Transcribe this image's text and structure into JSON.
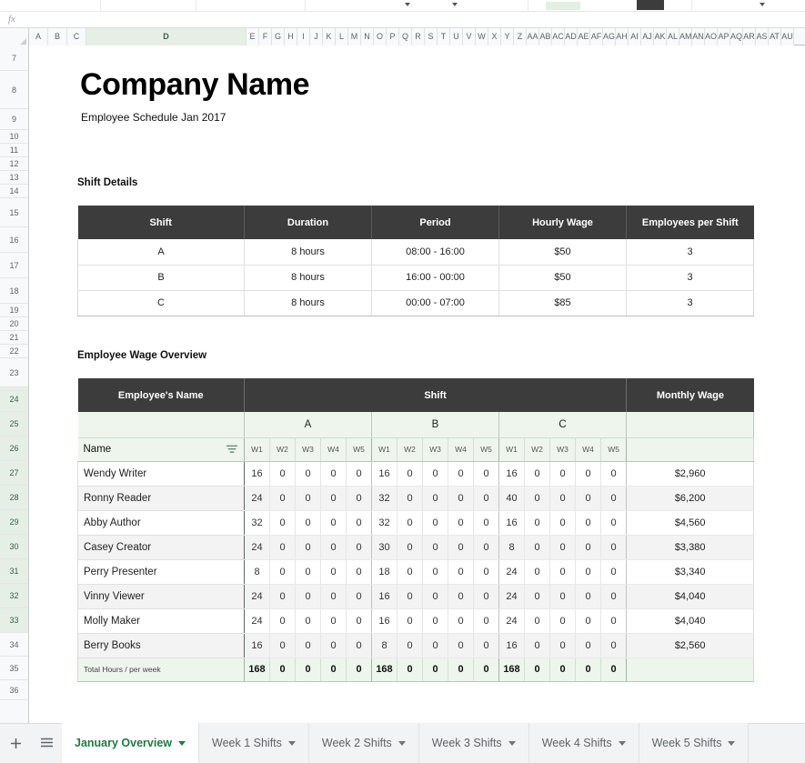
{
  "formula_bar": {
    "fx_label": "fx",
    "value": "",
    "placeholder": ""
  },
  "grid": {
    "columns": [
      "A",
      "B",
      "C",
      "D",
      "E",
      "F",
      "G",
      "H",
      "I",
      "J",
      "K",
      "L",
      "M",
      "N",
      "O",
      "P",
      "Q",
      "R",
      "S",
      "T",
      "U",
      "V",
      "W",
      "X",
      "Y",
      "Z",
      "AA",
      "AB",
      "AC",
      "AD",
      "AE",
      "AF",
      "AG",
      "AH",
      "AI",
      "AJ",
      "AK",
      "AL",
      "AM",
      "AN",
      "AO",
      "AP",
      "AQ",
      "AR",
      "AS",
      "AT",
      "AU"
    ],
    "selected_column": "D",
    "rows": [
      "7",
      "8",
      "9",
      "10",
      "11",
      "12",
      "13",
      "14",
      "15",
      "16",
      "17",
      "18",
      "19",
      "20",
      "21",
      "22",
      "23",
      "24",
      "25",
      "26",
      "27",
      "28",
      "29",
      "30",
      "31",
      "32",
      "33",
      "34",
      "35",
      "36"
    ],
    "selected_rows": [
      "24",
      "25",
      "26",
      "27",
      "28",
      "29",
      "30",
      "31",
      "32",
      "33"
    ]
  },
  "header": {
    "company_title": "Company Name",
    "subtitle": "Employee Schedule Jan 2017"
  },
  "shift_details": {
    "section_title": "Shift Details",
    "columns": [
      "Shift",
      "Duration",
      "Period",
      "Hourly Wage",
      "Employees per Shift"
    ],
    "rows": [
      {
        "shift": "A",
        "duration": "8 hours",
        "period": "08:00 - 16:00",
        "hourly_wage": "$50",
        "employees": "3"
      },
      {
        "shift": "B",
        "duration": "8 hours",
        "period": "16:00 - 00:00",
        "hourly_wage": "$50",
        "employees": "3"
      },
      {
        "shift": "C",
        "duration": "8 hours",
        "period": "00:00 - 07:00",
        "hourly_wage": "$85",
        "employees": "3"
      }
    ]
  },
  "wage_overview": {
    "section_title": "Employee Wage Overview",
    "header_name": "Employee's Name",
    "header_shift": "Shift",
    "header_monthly_wage": "Monthly Wage",
    "shift_groups": [
      "A",
      "B",
      "C"
    ],
    "week_labels": [
      "W1",
      "W2",
      "W3",
      "W4",
      "W5"
    ],
    "name_filter_label": "Name",
    "filter_icon": "filter-icon",
    "employees": [
      {
        "name": "Wendy Writer",
        "a": [
          "16",
          "0",
          "0",
          "0",
          "0"
        ],
        "b": [
          "16",
          "0",
          "0",
          "0",
          "0"
        ],
        "c": [
          "16",
          "0",
          "0",
          "0",
          "0"
        ],
        "monthly_wage": "$2,960"
      },
      {
        "name": "Ronny Reader",
        "a": [
          "24",
          "0",
          "0",
          "0",
          "0"
        ],
        "b": [
          "32",
          "0",
          "0",
          "0",
          "0"
        ],
        "c": [
          "40",
          "0",
          "0",
          "0",
          "0"
        ],
        "monthly_wage": "$6,200"
      },
      {
        "name": "Abby Author",
        "a": [
          "32",
          "0",
          "0",
          "0",
          "0"
        ],
        "b": [
          "32",
          "0",
          "0",
          "0",
          "0"
        ],
        "c": [
          "16",
          "0",
          "0",
          "0",
          "0"
        ],
        "monthly_wage": "$4,560"
      },
      {
        "name": "Casey Creator",
        "a": [
          "24",
          "0",
          "0",
          "0",
          "0"
        ],
        "b": [
          "30",
          "0",
          "0",
          "0",
          "0"
        ],
        "c": [
          "8",
          "0",
          "0",
          "0",
          "0"
        ],
        "monthly_wage": "$3,380"
      },
      {
        "name": "Perry Presenter",
        "a": [
          "8",
          "0",
          "0",
          "0",
          "0"
        ],
        "b": [
          "18",
          "0",
          "0",
          "0",
          "0"
        ],
        "c": [
          "24",
          "0",
          "0",
          "0",
          "0"
        ],
        "monthly_wage": "$3,340"
      },
      {
        "name": "Vinny Viewer",
        "a": [
          "24",
          "0",
          "0",
          "0",
          "0"
        ],
        "b": [
          "16",
          "0",
          "0",
          "0",
          "0"
        ],
        "c": [
          "24",
          "0",
          "0",
          "0",
          "0"
        ],
        "monthly_wage": "$4,040"
      },
      {
        "name": "Molly Maker",
        "a": [
          "24",
          "0",
          "0",
          "0",
          "0"
        ],
        "b": [
          "16",
          "0",
          "0",
          "0",
          "0"
        ],
        "c": [
          "24",
          "0",
          "0",
          "0",
          "0"
        ],
        "monthly_wage": "$4,040"
      },
      {
        "name": "Berry Books",
        "a": [
          "16",
          "0",
          "0",
          "0",
          "0"
        ],
        "b": [
          "8",
          "0",
          "0",
          "0",
          "0"
        ],
        "c": [
          "16",
          "0",
          "0",
          "0",
          "0"
        ],
        "monthly_wage": "$2,560"
      }
    ],
    "totals": {
      "label": "Total Hours / per week",
      "a": [
        "168",
        "0",
        "0",
        "0",
        "0"
      ],
      "b": [
        "168",
        "0",
        "0",
        "0",
        "0"
      ],
      "c": [
        "168",
        "0",
        "0",
        "0",
        "0"
      ],
      "monthly_wage": ""
    }
  },
  "tabbar": {
    "add_sheet_icon": "plus-icon",
    "all_sheets_icon": "hamburger-menu-icon",
    "tabs": [
      {
        "label": "January Overview",
        "active": true
      },
      {
        "label": "Week 1 Shifts",
        "active": false
      },
      {
        "label": "Week 2 Shifts",
        "active": false
      },
      {
        "label": "Week 3 Shifts",
        "active": false
      },
      {
        "label": "Week 4 Shifts",
        "active": false
      },
      {
        "label": "Week 5 Shifts",
        "active": false
      }
    ]
  },
  "colors": {
    "header_dark": "#3c3c3c",
    "accent_green": "#1f7a43",
    "group_green": "#eef5ed",
    "selection_green": "#e6efe6"
  }
}
